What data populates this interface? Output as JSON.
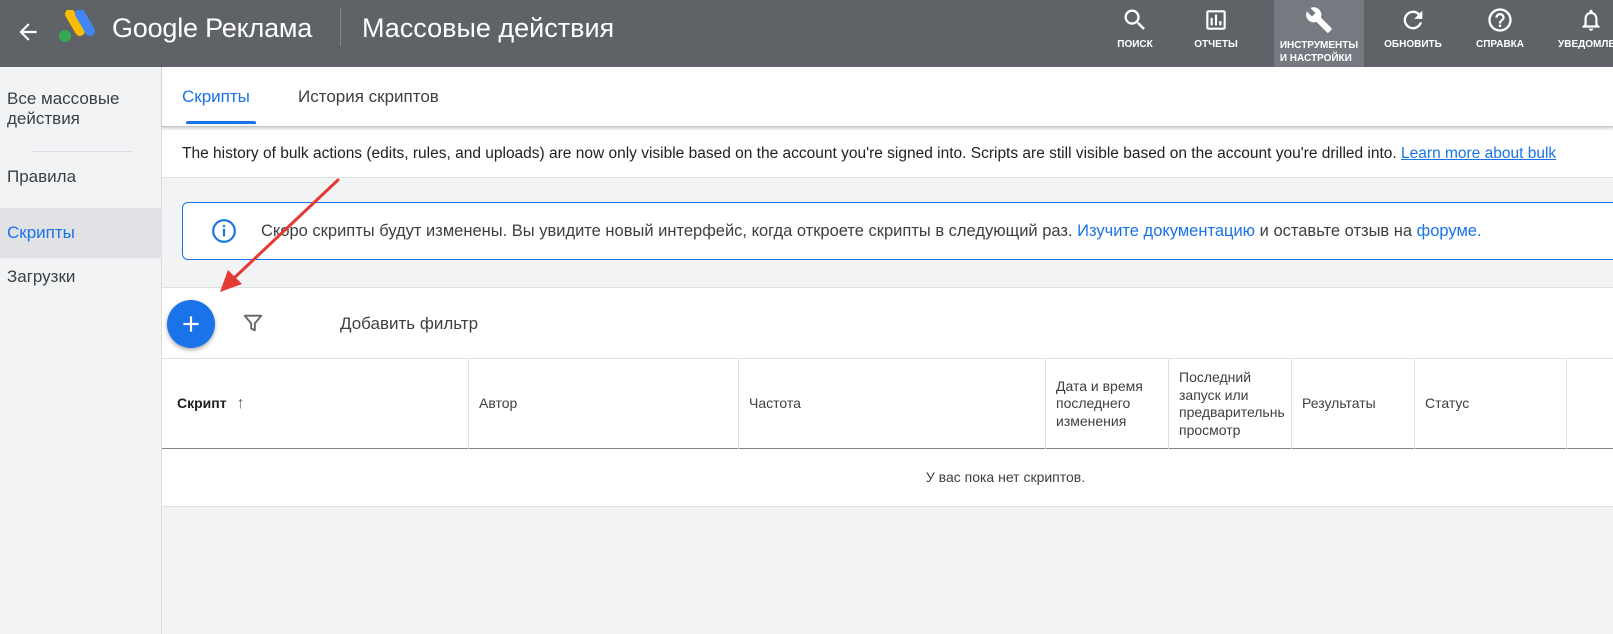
{
  "topbar": {
    "brand": "Google Реклама",
    "page_title": "Массовые действия",
    "tools": [
      {
        "label": "ПОИСК",
        "icon": "search-icon"
      },
      {
        "label": "ОТЧЕТЫ",
        "icon": "reports-icon"
      },
      {
        "label": "ИНСТРУМЕНТЫ",
        "label2": "И НАСТРОЙКИ",
        "icon": "wrench-icon",
        "active": true
      },
      {
        "label": "ОБНОВИТЬ",
        "icon": "refresh-icon"
      },
      {
        "label": "СПРАВКА",
        "icon": "help-icon"
      },
      {
        "label": "УВЕДОМЛЕ",
        "icon": "bell-icon"
      }
    ]
  },
  "sidebar": {
    "items": [
      {
        "label": "Все массовые",
        "label2": "действия"
      },
      {
        "label": "Правила"
      },
      {
        "label": "Скрипты",
        "active": true
      },
      {
        "label": "Загрузки"
      }
    ]
  },
  "tabs": [
    {
      "label": "Скрипты",
      "active": true
    },
    {
      "label": "История скриптов"
    }
  ],
  "notice": {
    "text": "The history of bulk actions (edits, rules, and uploads) are now only visible based on the account you're signed into. Scripts are still visible based on the account you're drilled into. ",
    "link": "Learn more about bulk"
  },
  "info": {
    "text": "Скоро скрипты будут изменены. Вы увидите новый интерфейс, когда откроете скрипты в следующий раз. ",
    "link1": "Изучите документацию",
    "middle": " и оставьте отзыв на ",
    "link2": "форуме."
  },
  "toolbar": {
    "add_filter": "Добавить фильтр"
  },
  "table": {
    "columns": [
      "Скрипт",
      "Автор",
      "Частота",
      "Дата и время последнего изменения",
      "Последний запуск или предварительный просмотр",
      "Результаты",
      "Статус"
    ],
    "sort_indicator": "↑",
    "empty_message": "У вас пока нет скриптов."
  },
  "colors": {
    "topbar": "#5f6368",
    "accent": "#1a73e8",
    "annotation_arrow": "#e53935"
  }
}
